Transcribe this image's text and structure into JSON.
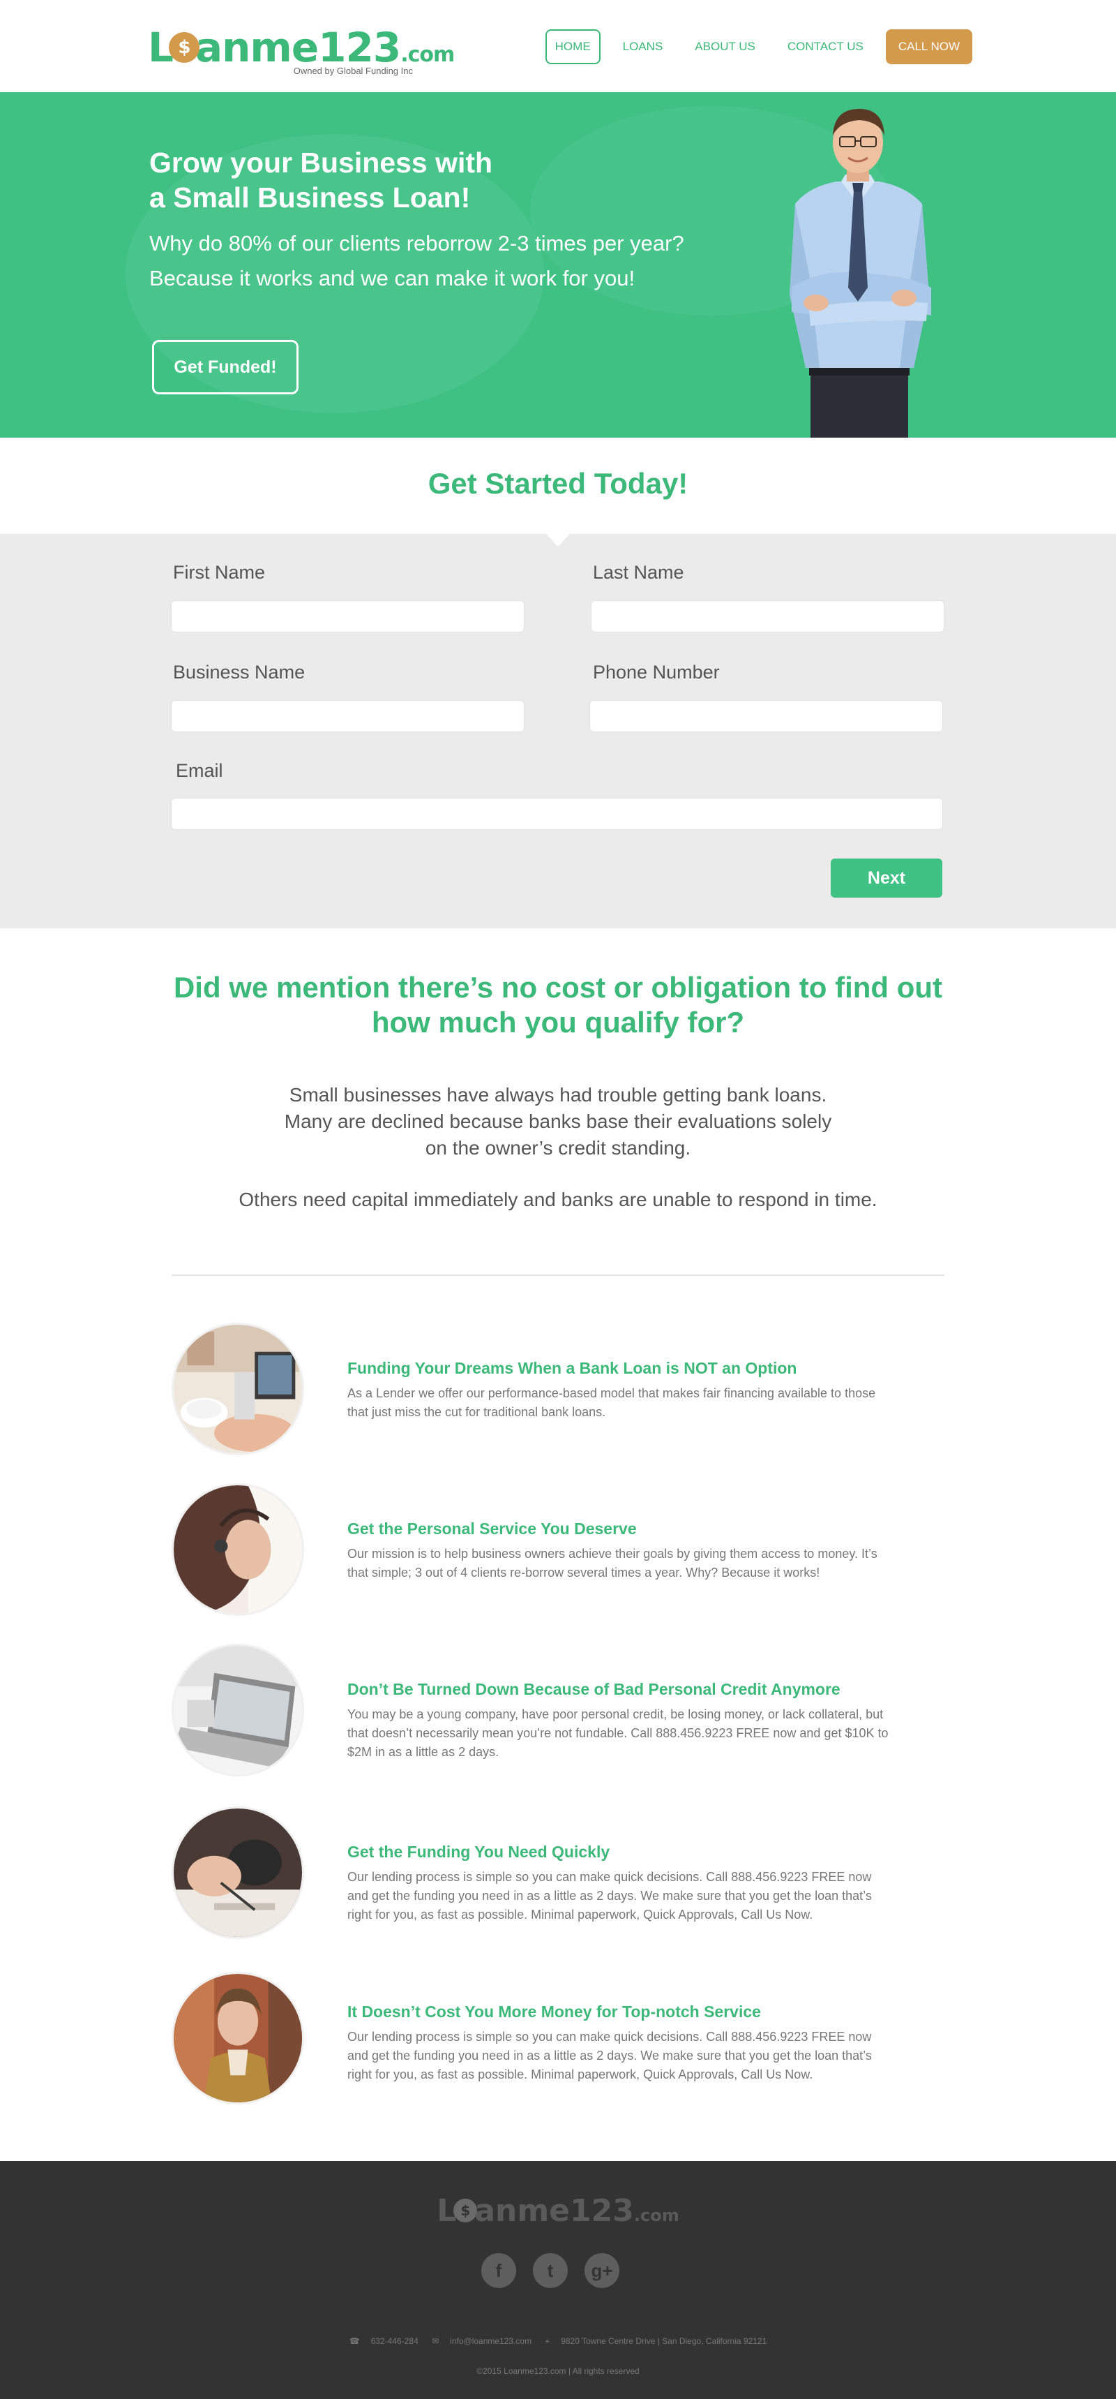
{
  "header": {
    "logo_text": "Loanme123",
    "logo_dotcom": ".com",
    "logo_sub": "Owned by Global Funding Inc",
    "nav": [
      {
        "label": "HOME"
      },
      {
        "label": "LOANS"
      },
      {
        "label": "ABOUT US"
      },
      {
        "label": "CONTACT US"
      },
      {
        "label": "CALL NOW"
      }
    ]
  },
  "hero": {
    "title_line1": "Grow your Business with",
    "title_line2": "a Small Business Loan!",
    "sub_line1": "Why do 80% of our clients reborrow 2-3 times per year?",
    "sub_line2": "Because it works and we can make it work for you!",
    "button": "Get Funded!"
  },
  "started": {
    "title": "Get Started Today!"
  },
  "form": {
    "first_name_label": "First Name",
    "last_name_label": "Last Name",
    "business_name_label": "Business Name",
    "phone_label": "Phone Number",
    "email_label": "Email",
    "first_name_value": "",
    "last_name_value": "",
    "business_name_value": "",
    "phone_value": "",
    "email_value": "",
    "next_button": "Next"
  },
  "mention": {
    "title_line1": "Did we mention there’s no cost or obligation to find out",
    "title_line2": "how much you qualify for?",
    "p1_line1": "Small businesses have always had trouble getting bank loans.",
    "p1_line2": "Many are declined because banks base their evaluations solely",
    "p1_line3": "on the owner’s credit standing.",
    "p2": "Others need capital immediately and banks are unable to respond in time."
  },
  "features": [
    {
      "title": "Funding Your Dreams When a Bank Loan is NOT an Option",
      "text": "As a Lender we offer our performance-based model that makes fair financing available to those that just miss the cut for traditional bank loans."
    },
    {
      "title": "Get the Personal Service You Deserve",
      "text": "Our mission is to help business owners achieve their goals by giving them access to money. It’s that simple; 3 out of 4 clients re-borrow several times a year. Why? Because it works!"
    },
    {
      "title": "Don’t Be Turned Down Because of Bad Personal Credit Anymore",
      "text": "You may be a young company, have poor personal credit, be losing money, or lack collateral, but that doesn’t necessarily mean you’re not fundable. Call 888.456.9223 FREE now and get $10K to $2M in as a little as 2 days."
    },
    {
      "title": "Get the Funding You Need Quickly",
      "text": "Our lending process is simple so you can make quick decisions. Call 888.456.9223 FREE now and get the funding you need in as a little as 2 days. We make sure that you get the loan that’s right for you, as fast as possible. Minimal paperwork, Quick Approvals, Call Us Now."
    },
    {
      "title": "It Doesn’t Cost You More Money for Top-notch Service",
      "text": "Our lending process is simple so you can make quick decisions. Call 888.456.9223 FREE now and get the funding you need in as a little as 2 days. We make sure that you get the loan that’s right for you, as fast as possible. Minimal paperwork, Quick Approvals, Call Us Now."
    }
  ],
  "footer": {
    "logo_text": "Loanme123",
    "logo_dotcom": ".com",
    "socials": [
      {
        "icon": "facebook-icon",
        "glyph": "f"
      },
      {
        "icon": "twitter-icon",
        "glyph": "t"
      },
      {
        "icon": "google-plus-icon",
        "glyph": "g+"
      }
    ],
    "phone": "632-446-284",
    "email": "info@loanme123.com",
    "address": "9820 Towne Centre Drive  |  San Diego, California 92121",
    "copyright": "©2015 Loanme123.com | All rights reserved"
  },
  "colors": {
    "brand_green": "#3cb879",
    "accent_orange": "#d39a4c",
    "form_bg": "#ebebeb",
    "footer_bg": "#333333"
  }
}
